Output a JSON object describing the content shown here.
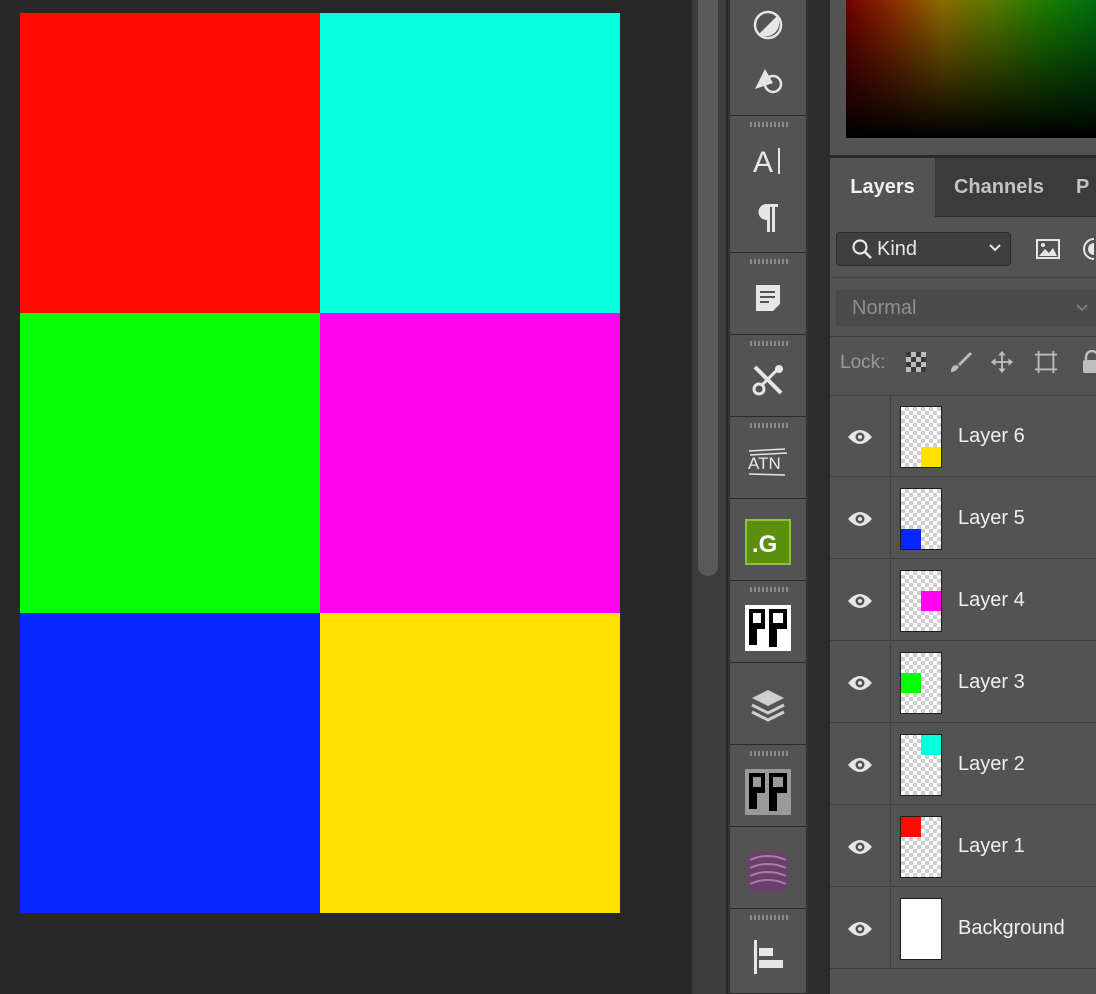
{
  "canvas": {
    "swatches": [
      {
        "name": "red",
        "color": "#ff0a00"
      },
      {
        "name": "cyan",
        "color": "#06ffde"
      },
      {
        "name": "green",
        "color": "#06ff06"
      },
      {
        "name": "magenta",
        "color": "#ff06ef"
      },
      {
        "name": "blue",
        "color": "#0625ff"
      },
      {
        "name": "yellow",
        "color": "#ffe100"
      }
    ]
  },
  "tool_strip": {
    "icons": [
      "channel-mixer-icon",
      "shape-rotate-icon",
      "character-icon",
      "paragraph-icon",
      "notes-icon",
      "tools-icon",
      "actions-atn-icon",
      "g-plugin-icon",
      "pixel-plugin-icon",
      "layers-stack-icon",
      "pixel-plugin-2-icon",
      "texture-swatch-icon",
      "align-icon"
    ]
  },
  "layers_panel": {
    "tabs": [
      {
        "label": "Layers",
        "active": true
      },
      {
        "label": "Channels",
        "active": false
      },
      {
        "label": "P",
        "active": false
      }
    ],
    "filter": {
      "label": "Kind"
    },
    "blend_mode": "Normal",
    "lock_label": "Lock:",
    "layers": [
      {
        "name": "Layer 6",
        "mark_color": "#ffe100"
      },
      {
        "name": "Layer 5",
        "mark_color": "#0625ff"
      },
      {
        "name": "Layer 4",
        "mark_color": "#ff06ef"
      },
      {
        "name": "Layer 3",
        "mark_color": "#06ff06"
      },
      {
        "name": "Layer 2",
        "mark_color": "#06ffde"
      },
      {
        "name": "Layer 1",
        "mark_color": "#ff0a00"
      },
      {
        "name": "Background",
        "mark_color": "#ffffff"
      }
    ]
  }
}
